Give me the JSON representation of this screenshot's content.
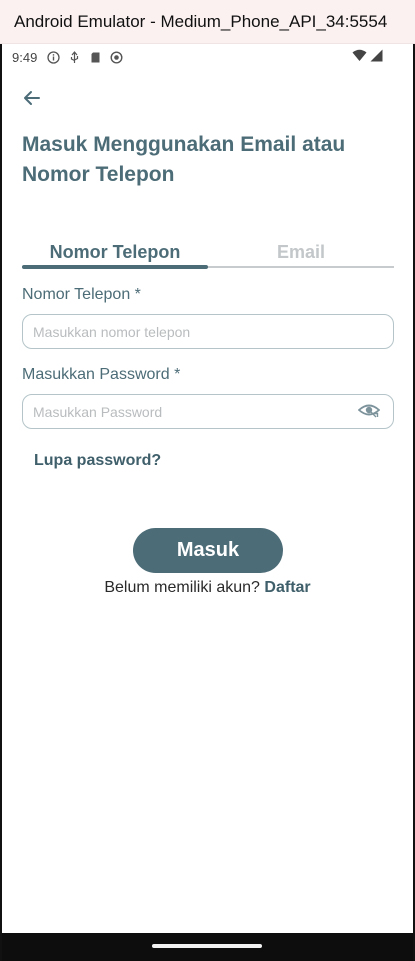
{
  "window": {
    "title": "Android Emulator - Medium_Phone_API_34:5554"
  },
  "status_bar": {
    "time": "9:49",
    "icons": [
      "info-icon",
      "usb-icon",
      "sd-card-icon",
      "sync-icon"
    ],
    "right_icons": [
      "wifi-icon",
      "signal-icon"
    ]
  },
  "header": {
    "title": "Masuk Menggunakan Email atau Nomor Telepon"
  },
  "tabs": [
    {
      "label": "Nomor Telepon",
      "active": true
    },
    {
      "label": "Email",
      "active": false
    }
  ],
  "form": {
    "phone_label": "Nomor Telepon *",
    "phone_placeholder": "Masukkan nomor telepon",
    "phone_value": "",
    "password_label": "Masukkan Password *",
    "password_placeholder": "Masukkan Password",
    "password_value": "",
    "forgot_label": "Lupa password?"
  },
  "actions": {
    "login_label": "Masuk",
    "register_prompt": "Belum memiliki akun?",
    "register_link": "Daftar"
  },
  "colors": {
    "primary": "#4c6c77",
    "inactive_tab": "#c3c7c9",
    "input_border": "#b4c4c9",
    "titlebar_bg": "#fbf1f1"
  }
}
